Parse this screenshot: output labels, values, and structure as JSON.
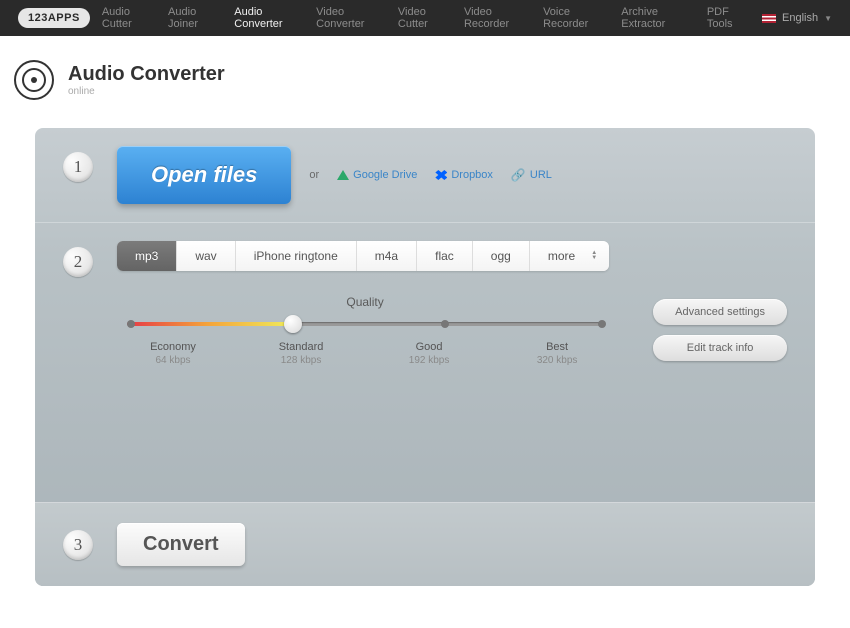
{
  "nav": {
    "logo": "123APPS",
    "links": [
      "Audio Cutter",
      "Audio Joiner",
      "Audio Converter",
      "Video Converter",
      "Video Cutter",
      "Video Recorder",
      "Voice Recorder",
      "Archive Extractor",
      "PDF Tools"
    ],
    "active_index": 2,
    "language": "English"
  },
  "header": {
    "title": "Audio Converter",
    "subtitle": "online"
  },
  "step1": {
    "number": "1",
    "open_label": "Open files",
    "or_label": "or",
    "sources": {
      "gdrive": "Google Drive",
      "dropbox": "Dropbox",
      "url": "URL"
    }
  },
  "step2": {
    "number": "2",
    "formats": [
      "mp3",
      "wav",
      "iPhone ringtone",
      "m4a",
      "flac",
      "ogg",
      "more"
    ],
    "active_format_index": 0,
    "quality": {
      "title": "Quality",
      "levels": [
        {
          "name": "Economy",
          "rate": "64 kbps"
        },
        {
          "name": "Standard",
          "rate": "128 kbps"
        },
        {
          "name": "Good",
          "rate": "192 kbps"
        },
        {
          "name": "Best",
          "rate": "320 kbps"
        }
      ],
      "selected_index": 1
    },
    "advanced_label": "Advanced settings",
    "edit_track_label": "Edit track info"
  },
  "step3": {
    "number": "3",
    "convert_label": "Convert"
  }
}
